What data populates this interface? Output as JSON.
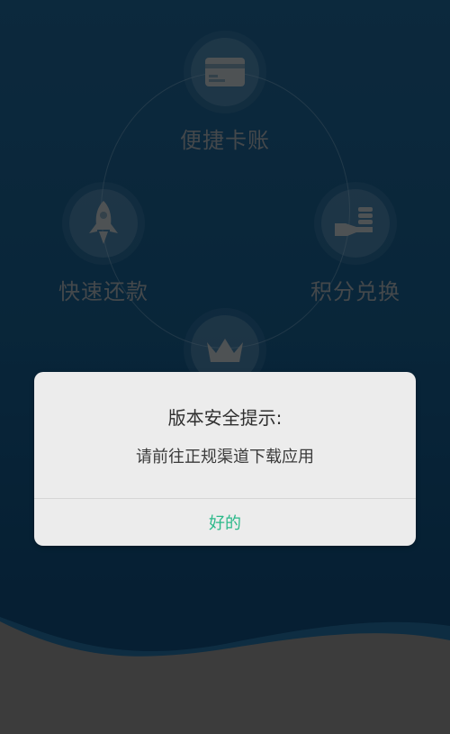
{
  "features": [
    {
      "label": "便捷卡账",
      "icon": "card-icon"
    },
    {
      "label": "快速还款",
      "icon": "rocket-icon"
    },
    {
      "label": "积分兑换",
      "icon": "coins-hand-icon"
    },
    {
      "label": "",
      "icon": "crown-icon"
    }
  ],
  "dialog": {
    "title": "版本安全提示:",
    "message": "请前往正规渠道下载应用",
    "ok_label": "好的"
  },
  "colors": {
    "accent": "#2bb98a",
    "background": "#114569",
    "wave": "#6e6e6e"
  }
}
